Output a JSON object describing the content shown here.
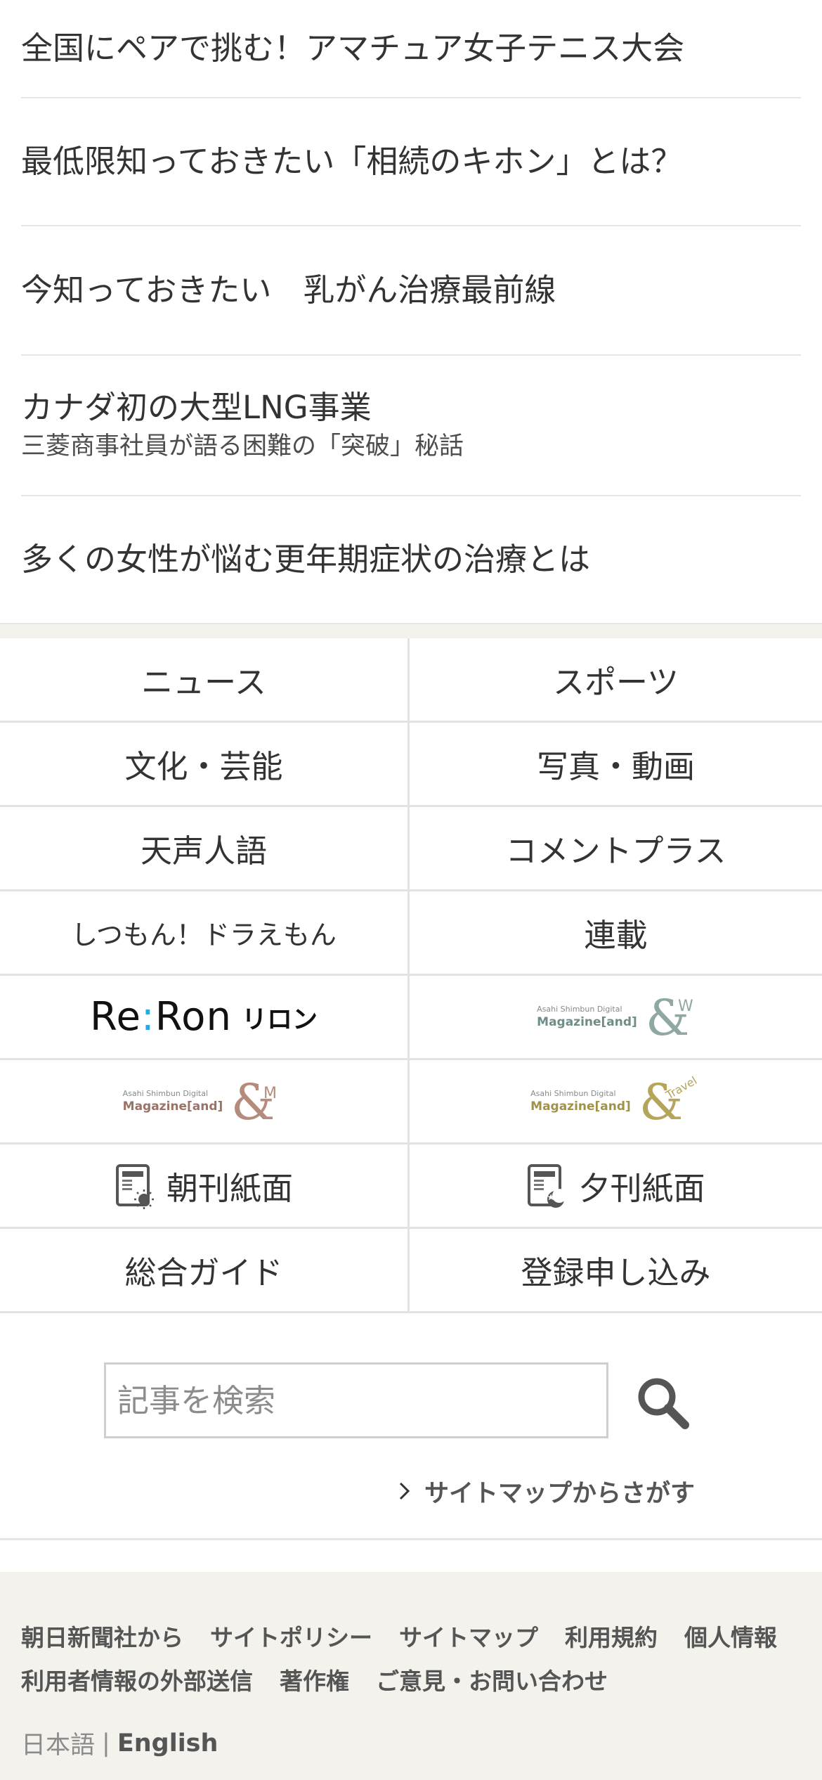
{
  "articles": [
    {
      "title": "全国にペアで挑む！アマチュア女子テニス大会",
      "subtitle": ""
    },
    {
      "title": "最低限知っておきたい「相続のキホン」とは？",
      "subtitle": ""
    },
    {
      "title": "今知っておきたい　乳がん治療最前線",
      "subtitle": ""
    },
    {
      "title": "カナダ初の大型LNG事業",
      "subtitle": "三菱商事社員が語る困難の「突破」秘話"
    },
    {
      "title": "多くの女性が悩む更年期症状の治療とは",
      "subtitle": ""
    }
  ],
  "grid": {
    "news": "ニュース",
    "sports": "スポーツ",
    "culture": "文化・芸能",
    "photo_video": "写真・動画",
    "tensei_jingo": "天声人語",
    "comment_plus": "コメントプラス",
    "shitsumon": "しつもん！ドラえもん",
    "serial": "連載",
    "reron": {
      "word": "Re:Ron",
      "kana": "リロン"
    },
    "and_w": {
      "top": "Asahi Shimbun Digital",
      "bottom": "Magazine[and]",
      "mark": "&",
      "suffix": "W",
      "color": "#8fa8a3"
    },
    "and_m": {
      "top": "Asahi Shimbun Digital",
      "bottom": "Magazine[and]",
      "mark": "&",
      "suffix": "M",
      "color": "#b48b7c"
    },
    "and_travel": {
      "top": "Asahi Shimbun Digital",
      "bottom": "Magazine[and]",
      "mark": "&",
      "suffix": "Travel",
      "color": "#b5a55a"
    },
    "morning_paper": "朝刊紙面",
    "evening_paper": "夕刊紙面",
    "guide": "総合ガイド",
    "register": "登録申し込み"
  },
  "search": {
    "placeholder": "記事を検索",
    "icon": "search-icon",
    "sitemap_link": "サイトマップからさがす"
  },
  "footer": {
    "links_row1": [
      "朝日新聞社から",
      "サイトポリシー",
      "サイトマップ",
      "利用規約",
      "個人情報"
    ],
    "links_row2": [
      "利用者情報の外部送信",
      "著作権",
      "ご意見・お問い合わせ"
    ],
    "lang_ja": "日本語",
    "lang_sep": "|",
    "lang_en": "English"
  },
  "colors": {
    "text": "#333333",
    "divider": "#e3e3e3",
    "footer_bg": "#f3f2ed",
    "reron_dot_blue": "#2ca8e0",
    "reron_dot_pink": "#e8418b"
  }
}
